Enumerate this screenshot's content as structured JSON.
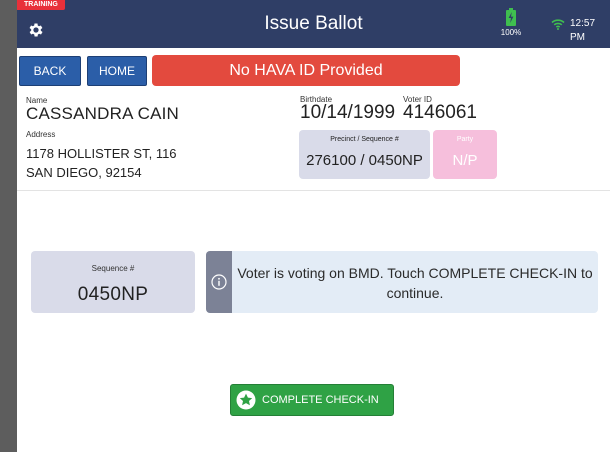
{
  "status_bar": {
    "training_badge": "TRAINING",
    "title": "Issue Ballot",
    "battery_percent": "100%",
    "time": "12:57 PM"
  },
  "actions": {
    "back_label": "BACK",
    "home_label": "HOME",
    "alert_text": "No HAVA ID Provided"
  },
  "voter": {
    "name_label": "Name",
    "name": "CASSANDRA CAIN",
    "address_label": "Address",
    "address_line1": "1178 HOLLISTER ST, 116",
    "address_line2": "SAN DIEGO, 92154",
    "birthdate_label": "Birthdate",
    "birthdate": "10/14/1999",
    "voter_id_label": "Voter ID",
    "voter_id": "4146061",
    "precinct_label": "Precinct / Sequence #",
    "precinct_value": "276100 / 0450NP",
    "party_label": "Party",
    "party_value": "N/P"
  },
  "sequence": {
    "label": "Sequence #",
    "value": "0450NP"
  },
  "info_message": "Voter is voting on BMD. Touch COMPLETE CHECK-IN to continue.",
  "complete_button_label": "COMPLETE CHECK-IN",
  "colors": {
    "header_bg": "#2f3e66",
    "nav_button": "#2b5ea8",
    "alert": "#e34a3e",
    "complete_button": "#2fa245",
    "party_box": "#f6bfdc",
    "info_bg": "#e3ecf6"
  },
  "icons": {
    "settings": "gear-icon",
    "battery": "battery-charging-icon",
    "wifi": "wifi-icon",
    "info": "info-icon",
    "complete": "star-icon"
  }
}
